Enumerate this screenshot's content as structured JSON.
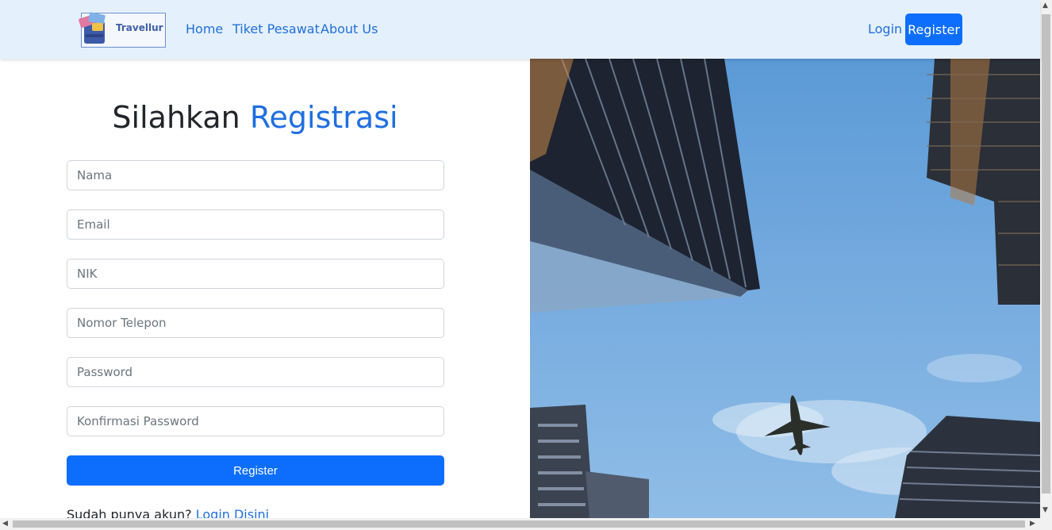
{
  "brand": {
    "name": "Travellur"
  },
  "nav": {
    "links": [
      "Home",
      "Tiket Pesawat",
      "About Us"
    ],
    "login_label": "Login",
    "register_label": "Register"
  },
  "form": {
    "title_part1": "Silahkan",
    "title_part2": "Registrasi",
    "fields": {
      "nama": "Nama",
      "email": "Email",
      "nik": "NIK",
      "telepon": "Nomor Telepon",
      "password": "Password",
      "konfirmasi": "Konfirmasi Password"
    },
    "submit_label": "Register",
    "hint_text": "Sudah punya akun?",
    "hint_link": "Login Disini"
  },
  "colors": {
    "primary": "#0d6efd",
    "navbar_bg": "#e5f0fd",
    "link": "#1f6fd8"
  },
  "icons": {
    "scroll_up": "▲",
    "scroll_down": "▼",
    "scroll_left": "◀",
    "scroll_right": "▶"
  }
}
